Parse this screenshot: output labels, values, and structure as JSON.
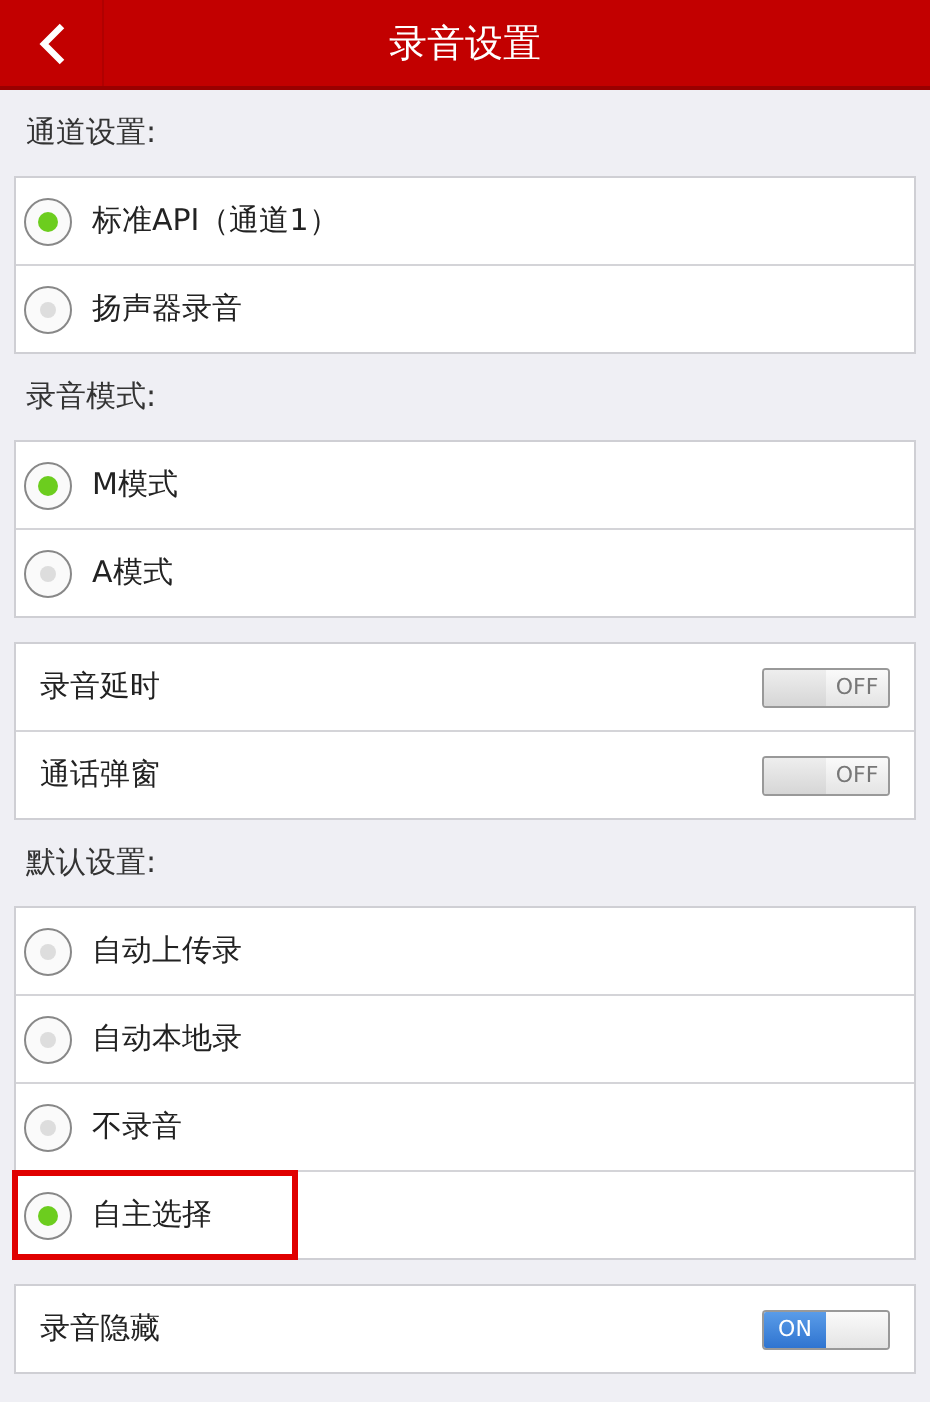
{
  "title_bar": {
    "title": "录音设置"
  },
  "sections": [
    {
      "header": "通道设置:",
      "kind": "radio",
      "items": [
        {
          "label": "标准API（通道1）",
          "selected": true,
          "highlighted": false
        },
        {
          "label": "扬声器录音",
          "selected": false,
          "highlighted": false
        }
      ]
    },
    {
      "header": "录音模式:",
      "kind": "radio",
      "items": [
        {
          "label": "M模式",
          "selected": true,
          "highlighted": false
        },
        {
          "label": "A模式",
          "selected": false,
          "highlighted": false
        }
      ]
    },
    {
      "kind": "toggle",
      "items": [
        {
          "label": "录音延时",
          "on": false,
          "state_label": "OFF"
        },
        {
          "label": "通话弹窗",
          "on": false,
          "state_label": "OFF"
        }
      ]
    },
    {
      "header": "默认设置:",
      "kind": "radio",
      "items": [
        {
          "label": "自动上传录",
          "selected": false,
          "highlighted": false
        },
        {
          "label": "自动本地录",
          "selected": false,
          "highlighted": false
        },
        {
          "label": "不录音",
          "selected": false,
          "highlighted": false
        },
        {
          "label": "自主选择",
          "selected": true,
          "highlighted": true
        }
      ]
    },
    {
      "kind": "toggle",
      "items": [
        {
          "label": "录音隐藏",
          "on": true,
          "state_label": "ON"
        }
      ]
    }
  ]
}
